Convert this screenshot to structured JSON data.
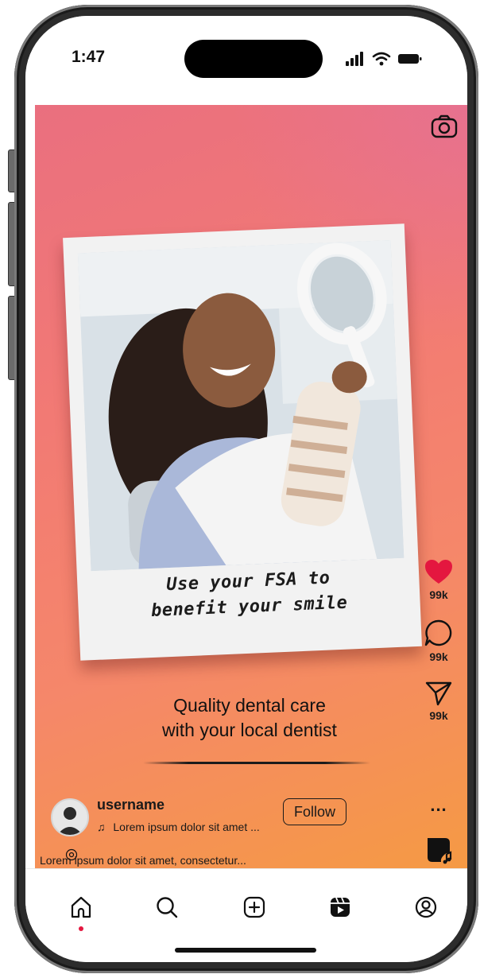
{
  "status_bar": {
    "time": "1:47"
  },
  "post": {
    "photo_caption_line1": "Use your FSA to",
    "photo_caption_line2": "benefit your smile",
    "headline_line1": "Quality dental care",
    "headline_line2": "with your local dentist"
  },
  "actions": {
    "like_count": "99k",
    "comment_count": "99k",
    "share_count": "99k",
    "more_label": "..."
  },
  "author": {
    "username": "username",
    "song": "Lorem ipsum dolor sit amet ...",
    "follow_label": "Follow"
  },
  "caption": "Lorem ipsum dolor sit amet, consectetur...",
  "colors": {
    "like": "#e4173f",
    "gradient_top": "#ea6f7f",
    "gradient_bottom": "#f59a44"
  },
  "icons": [
    "camera-icon",
    "heart-icon",
    "comment-icon",
    "send-icon",
    "music-note-icon",
    "home-icon",
    "search-icon",
    "add-icon",
    "reels-icon",
    "profile-icon"
  ]
}
